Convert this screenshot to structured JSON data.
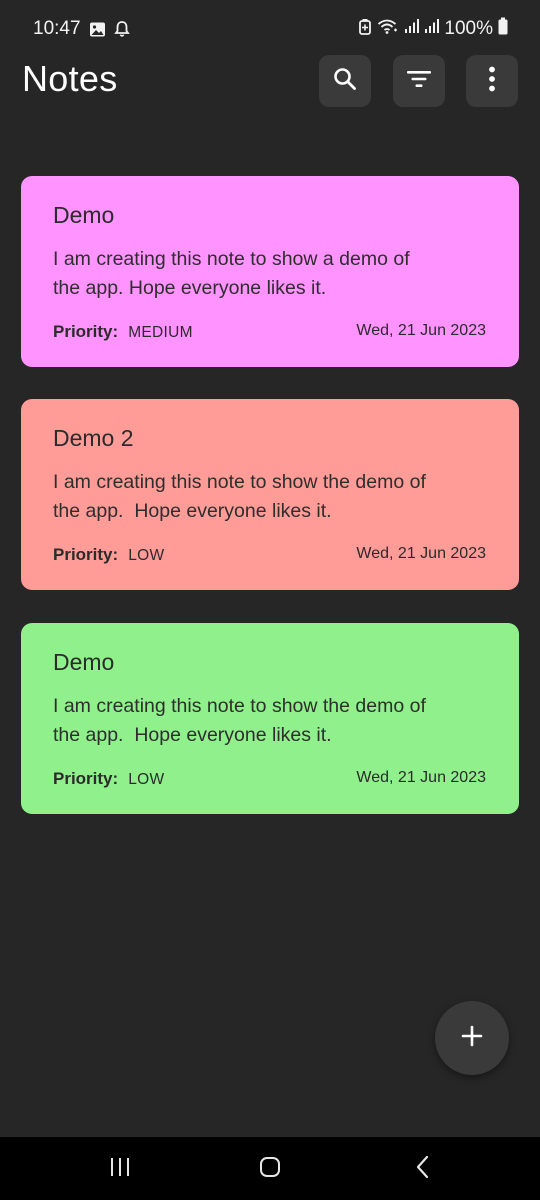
{
  "status_bar": {
    "time": "10:47",
    "battery": "100%",
    "icons": [
      "gallery-icon",
      "alarm-icon",
      "battery-saver-icon",
      "wifi-icon",
      "signal-icon",
      "signal-icon",
      "battery-icon"
    ]
  },
  "app_bar": {
    "title": "Notes",
    "actions": [
      "search-icon",
      "filter-icon",
      "more-vert-icon"
    ]
  },
  "notes": [
    {
      "title": "Demo",
      "body": "I am creating this note to show a demo of\nthe app. Hope everyone likes it.",
      "priority_label": "Priority:",
      "priority": "MEDIUM",
      "date": "Wed, 21 Jun 2023",
      "color": "#ff93ff"
    },
    {
      "title": "Demo 2",
      "body": "I am creating this note to show the demo of\nthe app.  Hope everyone likes it.",
      "priority_label": "Priority:",
      "priority": "LOW",
      "date": "Wed, 21 Jun 2023",
      "color": "#ff9c98"
    },
    {
      "title": "Demo",
      "body": "I am creating this note to show the demo of\nthe app.  Hope everyone likes it.",
      "priority_label": "Priority:",
      "priority": "LOW",
      "date": "Wed, 21 Jun 2023",
      "color": "#90f08c"
    }
  ],
  "fab": {
    "icon": "add-icon"
  },
  "nav_bar": {
    "buttons": [
      "recents-icon",
      "home-icon",
      "back-icon"
    ]
  },
  "colors": {
    "background": "#262626",
    "button_bg": "#3a3a3a"
  }
}
